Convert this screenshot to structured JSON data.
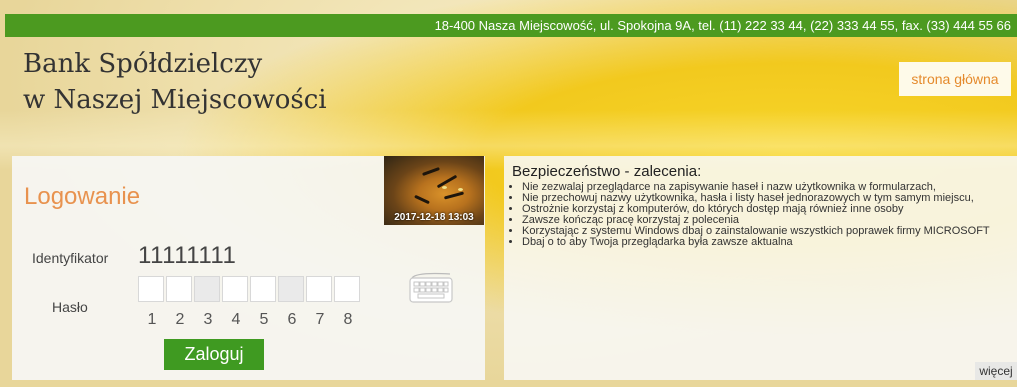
{
  "header": {
    "address": "18-400 Nasza Miejscowość, ul. Spokojna 9A, tel. (11) 222 33 44, (22) 333 44 55, fax. (33) 444 55 66",
    "bank_name_line1": "Bank Spółdzielczy",
    "bank_name_line2": "w Naszej Miejscowości",
    "home_link": "strona główna"
  },
  "login": {
    "title": "Logowanie",
    "photo_date": "2017-12-18 13:03",
    "identifier_label": "Identyfikator",
    "identifier_value": "11111111",
    "password_label": "Hasło",
    "password_positions": [
      "1",
      "2",
      "3",
      "4",
      "5",
      "6",
      "7",
      "8"
    ],
    "keyboard_icon": "virtual-keyboard-icon",
    "submit_label": "Zaloguj"
  },
  "security": {
    "title": "Bezpieczeństwo - zalecenia:",
    "items": [
      "Nie zezwalaj przeglądarce na zapisywanie haseł i nazw użytkownika w formularzach,",
      "Nie przechowuj nazwy użytkownika, hasła i listy haseł jednorazowych w tym samym miejscu,",
      "Ostrożnie korzystaj z komputerów, do których dostęp mają również inne osoby",
      "Zawsze kończąc pracę korzystaj z polecenia",
      "Korzystając z systemu Windows dbaj o zainstalowanie wszystkich poprawek firmy MICROSOFT",
      "Dbaj o to aby Twoja przeglądarka była zawsze aktualna"
    ],
    "more_label": "więcej"
  },
  "colors": {
    "green": "#4c9a20",
    "accent_orange": "#e8924e",
    "button_green": "#3f9a21"
  }
}
